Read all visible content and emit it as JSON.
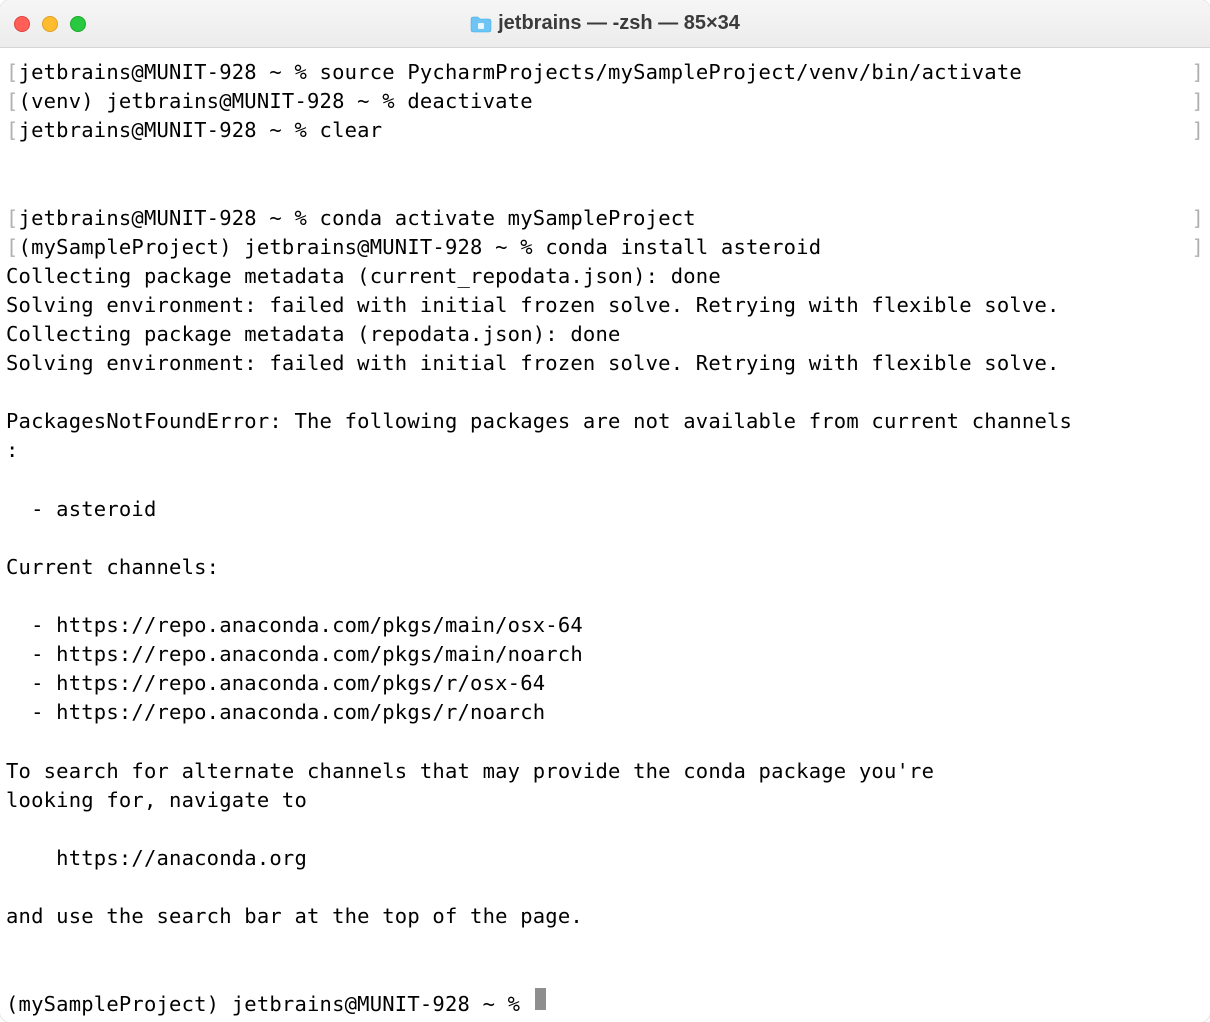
{
  "titlebar": {
    "title": "jetbrains — -zsh — 85×34",
    "folder_icon": "folder-icon"
  },
  "lines": [
    {
      "type": "bracket",
      "text": "jetbrains@MUNIT-928 ~ % source PycharmProjects/mySampleProject/venv/bin/activate"
    },
    {
      "type": "bracket",
      "text": "(venv) jetbrains@MUNIT-928 ~ % deactivate"
    },
    {
      "type": "bracket",
      "text": "jetbrains@MUNIT-928 ~ % clear"
    },
    {
      "type": "plain",
      "text": ""
    },
    {
      "type": "plain",
      "text": ""
    },
    {
      "type": "bracket",
      "text": "jetbrains@MUNIT-928 ~ % conda activate mySampleProject"
    },
    {
      "type": "bracket",
      "text": "(mySampleProject) jetbrains@MUNIT-928 ~ % conda install asteroid"
    },
    {
      "type": "plain",
      "text": "Collecting package metadata (current_repodata.json): done"
    },
    {
      "type": "plain",
      "text": "Solving environment: failed with initial frozen solve. Retrying with flexible solve."
    },
    {
      "type": "plain",
      "text": "Collecting package metadata (repodata.json): done"
    },
    {
      "type": "plain",
      "text": "Solving environment: failed with initial frozen solve. Retrying with flexible solve."
    },
    {
      "type": "plain",
      "text": ""
    },
    {
      "type": "plain",
      "text": "PackagesNotFoundError: The following packages are not available from current channels"
    },
    {
      "type": "plain",
      "text": ":"
    },
    {
      "type": "plain",
      "text": ""
    },
    {
      "type": "plain",
      "text": "  - asteroid"
    },
    {
      "type": "plain",
      "text": ""
    },
    {
      "type": "plain",
      "text": "Current channels:"
    },
    {
      "type": "plain",
      "text": ""
    },
    {
      "type": "plain",
      "text": "  - https://repo.anaconda.com/pkgs/main/osx-64"
    },
    {
      "type": "plain",
      "text": "  - https://repo.anaconda.com/pkgs/main/noarch"
    },
    {
      "type": "plain",
      "text": "  - https://repo.anaconda.com/pkgs/r/osx-64"
    },
    {
      "type": "plain",
      "text": "  - https://repo.anaconda.com/pkgs/r/noarch"
    },
    {
      "type": "plain",
      "text": ""
    },
    {
      "type": "plain",
      "text": "To search for alternate channels that may provide the conda package you're"
    },
    {
      "type": "plain",
      "text": "looking for, navigate to"
    },
    {
      "type": "plain",
      "text": ""
    },
    {
      "type": "plain",
      "text": "    https://anaconda.org"
    },
    {
      "type": "plain",
      "text": ""
    },
    {
      "type": "plain",
      "text": "and use the search bar at the top of the page."
    },
    {
      "type": "plain",
      "text": ""
    },
    {
      "type": "plain",
      "text": ""
    },
    {
      "type": "cursor",
      "text": "(mySampleProject) jetbrains@MUNIT-928 ~ % "
    }
  ]
}
